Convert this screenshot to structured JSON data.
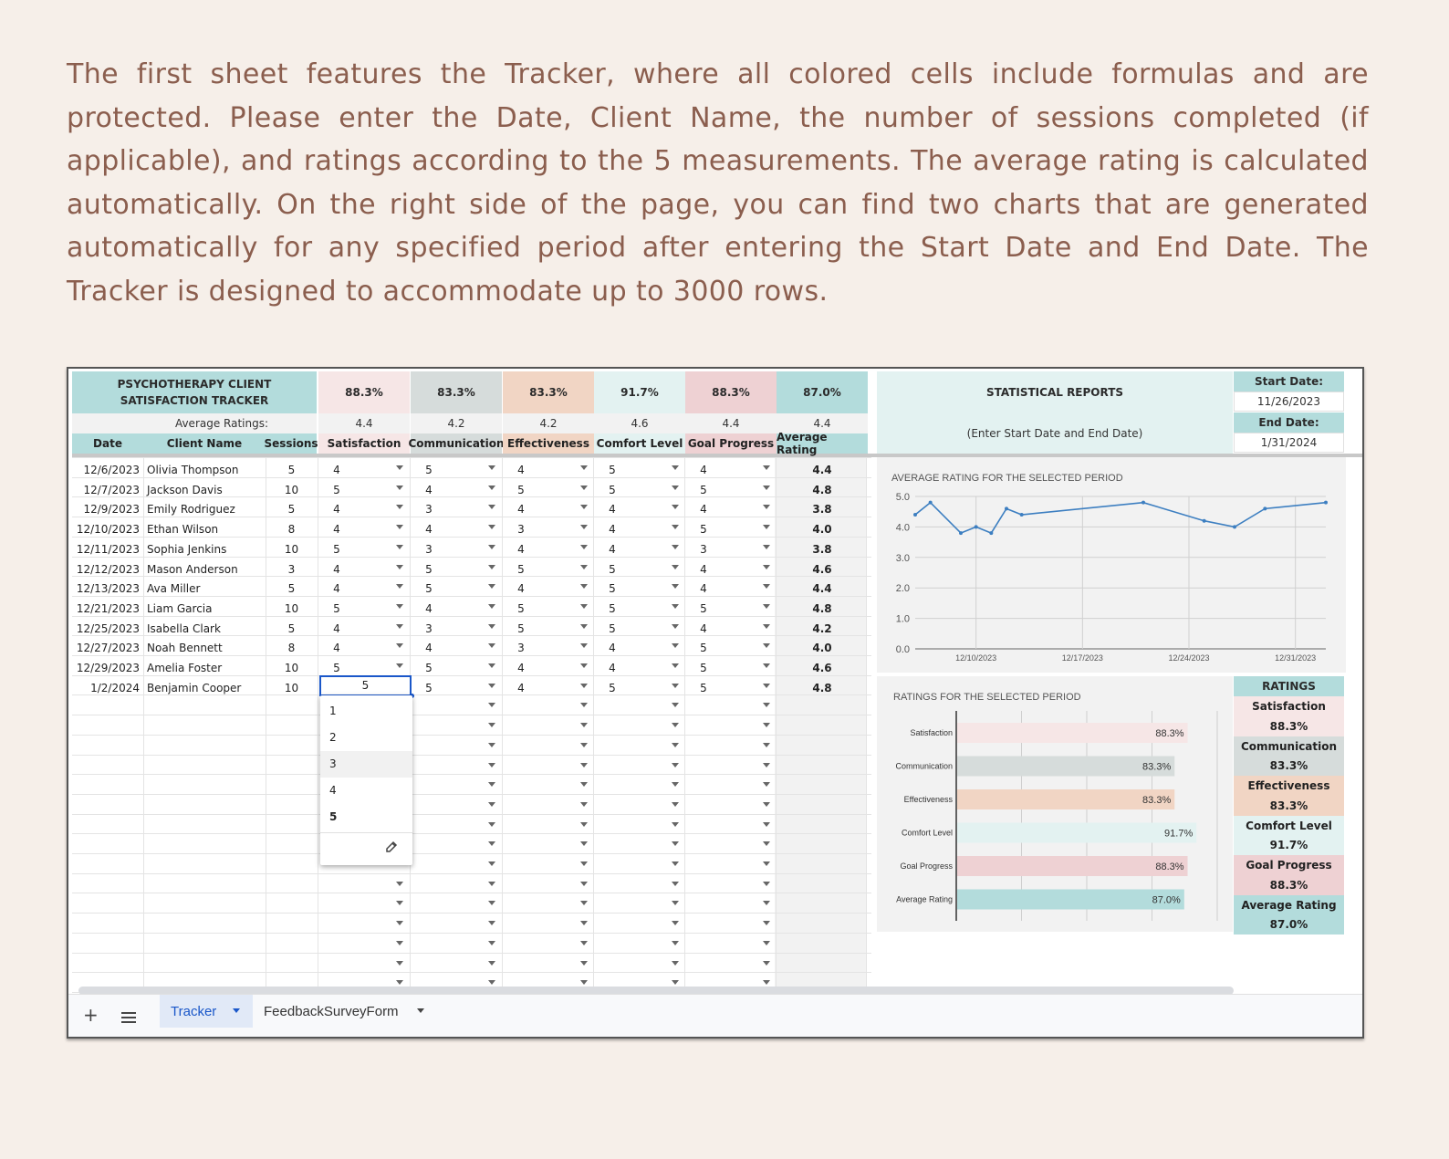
{
  "intro_text": "The first sheet features the Tracker, where all colored cells include formulas and are protected. Please enter the Date, Client Name, the number of sessions completed (if applicable), and ratings according to the 5 measurements. The average rating is calculated automatically. On the right side of the page, you can find two charts that are generated automatically for any specified period after entering the Start Date and End Date. The Tracker is designed to accommodate up to 3000 rows.",
  "tracker": {
    "title": "PSYCHOTHERAPY CLIENT SATISFACTION TRACKER",
    "avg_label": "Average Ratings:",
    "metrics": [
      {
        "pct": "88.3%",
        "avg": "4.4",
        "name": "Satisfaction",
        "color": "#f6e6e6"
      },
      {
        "pct": "83.3%",
        "avg": "4.2",
        "name": "Communication",
        "color": "#d6dcdb"
      },
      {
        "pct": "83.3%",
        "avg": "4.2",
        "name": "Effectiveness",
        "color": "#f1d5c4"
      },
      {
        "pct": "91.7%",
        "avg": "4.6",
        "name": "Comfort Level",
        "color": "#e3f2f1"
      },
      {
        "pct": "88.3%",
        "avg": "4.4",
        "name": "Goal Progress",
        "color": "#eed1d3"
      },
      {
        "pct": "87.0%",
        "avg": "4.4",
        "name": "Average Rating",
        "color": "#b3dcdc"
      }
    ],
    "col_date": "Date",
    "col_client": "Client Name",
    "col_sessions": "Sessions",
    "rows": [
      {
        "date": "12/6/2023",
        "client": "Olivia Thompson",
        "sessions": "5",
        "r": [
          "4",
          "5",
          "4",
          "5",
          "4"
        ],
        "avg": "4.4"
      },
      {
        "date": "12/7/2023",
        "client": "Jackson Davis",
        "sessions": "10",
        "r": [
          "5",
          "4",
          "5",
          "5",
          "5"
        ],
        "avg": "4.8"
      },
      {
        "date": "12/9/2023",
        "client": "Emily Rodriguez",
        "sessions": "5",
        "r": [
          "4",
          "3",
          "4",
          "4",
          "4"
        ],
        "avg": "3.8"
      },
      {
        "date": "12/10/2023",
        "client": "Ethan Wilson",
        "sessions": "8",
        "r": [
          "4",
          "4",
          "3",
          "4",
          "5"
        ],
        "avg": "4.0"
      },
      {
        "date": "12/11/2023",
        "client": "Sophia Jenkins",
        "sessions": "10",
        "r": [
          "5",
          "3",
          "4",
          "4",
          "3"
        ],
        "avg": "3.8"
      },
      {
        "date": "12/12/2023",
        "client": "Mason Anderson",
        "sessions": "3",
        "r": [
          "4",
          "5",
          "5",
          "5",
          "4"
        ],
        "avg": "4.6"
      },
      {
        "date": "12/13/2023",
        "client": "Ava Miller",
        "sessions": "5",
        "r": [
          "4",
          "5",
          "4",
          "5",
          "4"
        ],
        "avg": "4.4"
      },
      {
        "date": "12/21/2023",
        "client": "Liam Garcia",
        "sessions": "10",
        "r": [
          "5",
          "4",
          "5",
          "5",
          "5"
        ],
        "avg": "4.8"
      },
      {
        "date": "12/25/2023",
        "client": "Isabella Clark",
        "sessions": "5",
        "r": [
          "4",
          "3",
          "5",
          "5",
          "4"
        ],
        "avg": "4.2"
      },
      {
        "date": "12/27/2023",
        "client": "Noah Bennett",
        "sessions": "8",
        "r": [
          "4",
          "4",
          "3",
          "4",
          "5"
        ],
        "avg": "4.0"
      },
      {
        "date": "12/29/2023",
        "client": "Amelia Foster",
        "sessions": "10",
        "r": [
          "5",
          "5",
          "4",
          "4",
          "5"
        ],
        "avg": "4.6"
      },
      {
        "date": "1/2/2024",
        "client": "Benjamin Cooper",
        "sessions": "10",
        "r": [
          "5",
          "5",
          "4",
          "5",
          "5"
        ],
        "avg": "4.8"
      }
    ],
    "dropdown_options": [
      "1",
      "2",
      "3",
      "4",
      "5"
    ]
  },
  "stats": {
    "title": "STATISTICAL REPORTS",
    "hint": "(Enter Start Date and End Date)",
    "start_label": "Start Date:",
    "start_value": "11/26/2023",
    "end_label": "End Date:",
    "end_value": "1/31/2024",
    "ratings_label": "RATINGS"
  },
  "chart_data": [
    {
      "type": "line",
      "title": "AVERAGE RATING FOR THE SELECTED PERIOD",
      "x": [
        "2023-12-06",
        "2023-12-07",
        "2023-12-09",
        "2023-12-10",
        "2023-12-11",
        "2023-12-12",
        "2023-12-13",
        "2023-12-21",
        "2023-12-25",
        "2023-12-27",
        "2023-12-29",
        "2024-01-02"
      ],
      "values": [
        4.4,
        4.8,
        3.8,
        4.0,
        3.8,
        4.6,
        4.4,
        4.8,
        4.2,
        4.0,
        4.6,
        4.8
      ],
      "x_ticks": [
        "12/10/2023",
        "12/17/2023",
        "12/24/2023",
        "12/31/2023"
      ],
      "y_ticks": [
        "0.0",
        "1.0",
        "2.0",
        "3.0",
        "4.0",
        "5.0"
      ],
      "ylim": [
        0,
        5
      ],
      "color": "#3d7fc1"
    },
    {
      "type": "bar",
      "title": "RATINGS FOR THE SELECTED PERIOD",
      "categories": [
        "Satisfaction",
        "Communication",
        "Effectiveness",
        "Comfort Level",
        "Goal Progress",
        "Average Rating"
      ],
      "values": [
        88.3,
        83.3,
        83.3,
        91.7,
        88.3,
        87.0
      ],
      "labels": [
        "88.3%",
        "83.3%",
        "83.3%",
        "91.7%",
        "88.3%",
        "87.0%"
      ],
      "colors": [
        "#f6e6e6",
        "#d6dcdb",
        "#f1d5c4",
        "#e3f2f1",
        "#eed1d3",
        "#b3dcdc"
      ]
    }
  ],
  "tabs": {
    "add_icon": "plus-icon",
    "menu_icon": "list-icon",
    "tracker": "Tracker",
    "form": "FeedbackSurveyForm"
  }
}
